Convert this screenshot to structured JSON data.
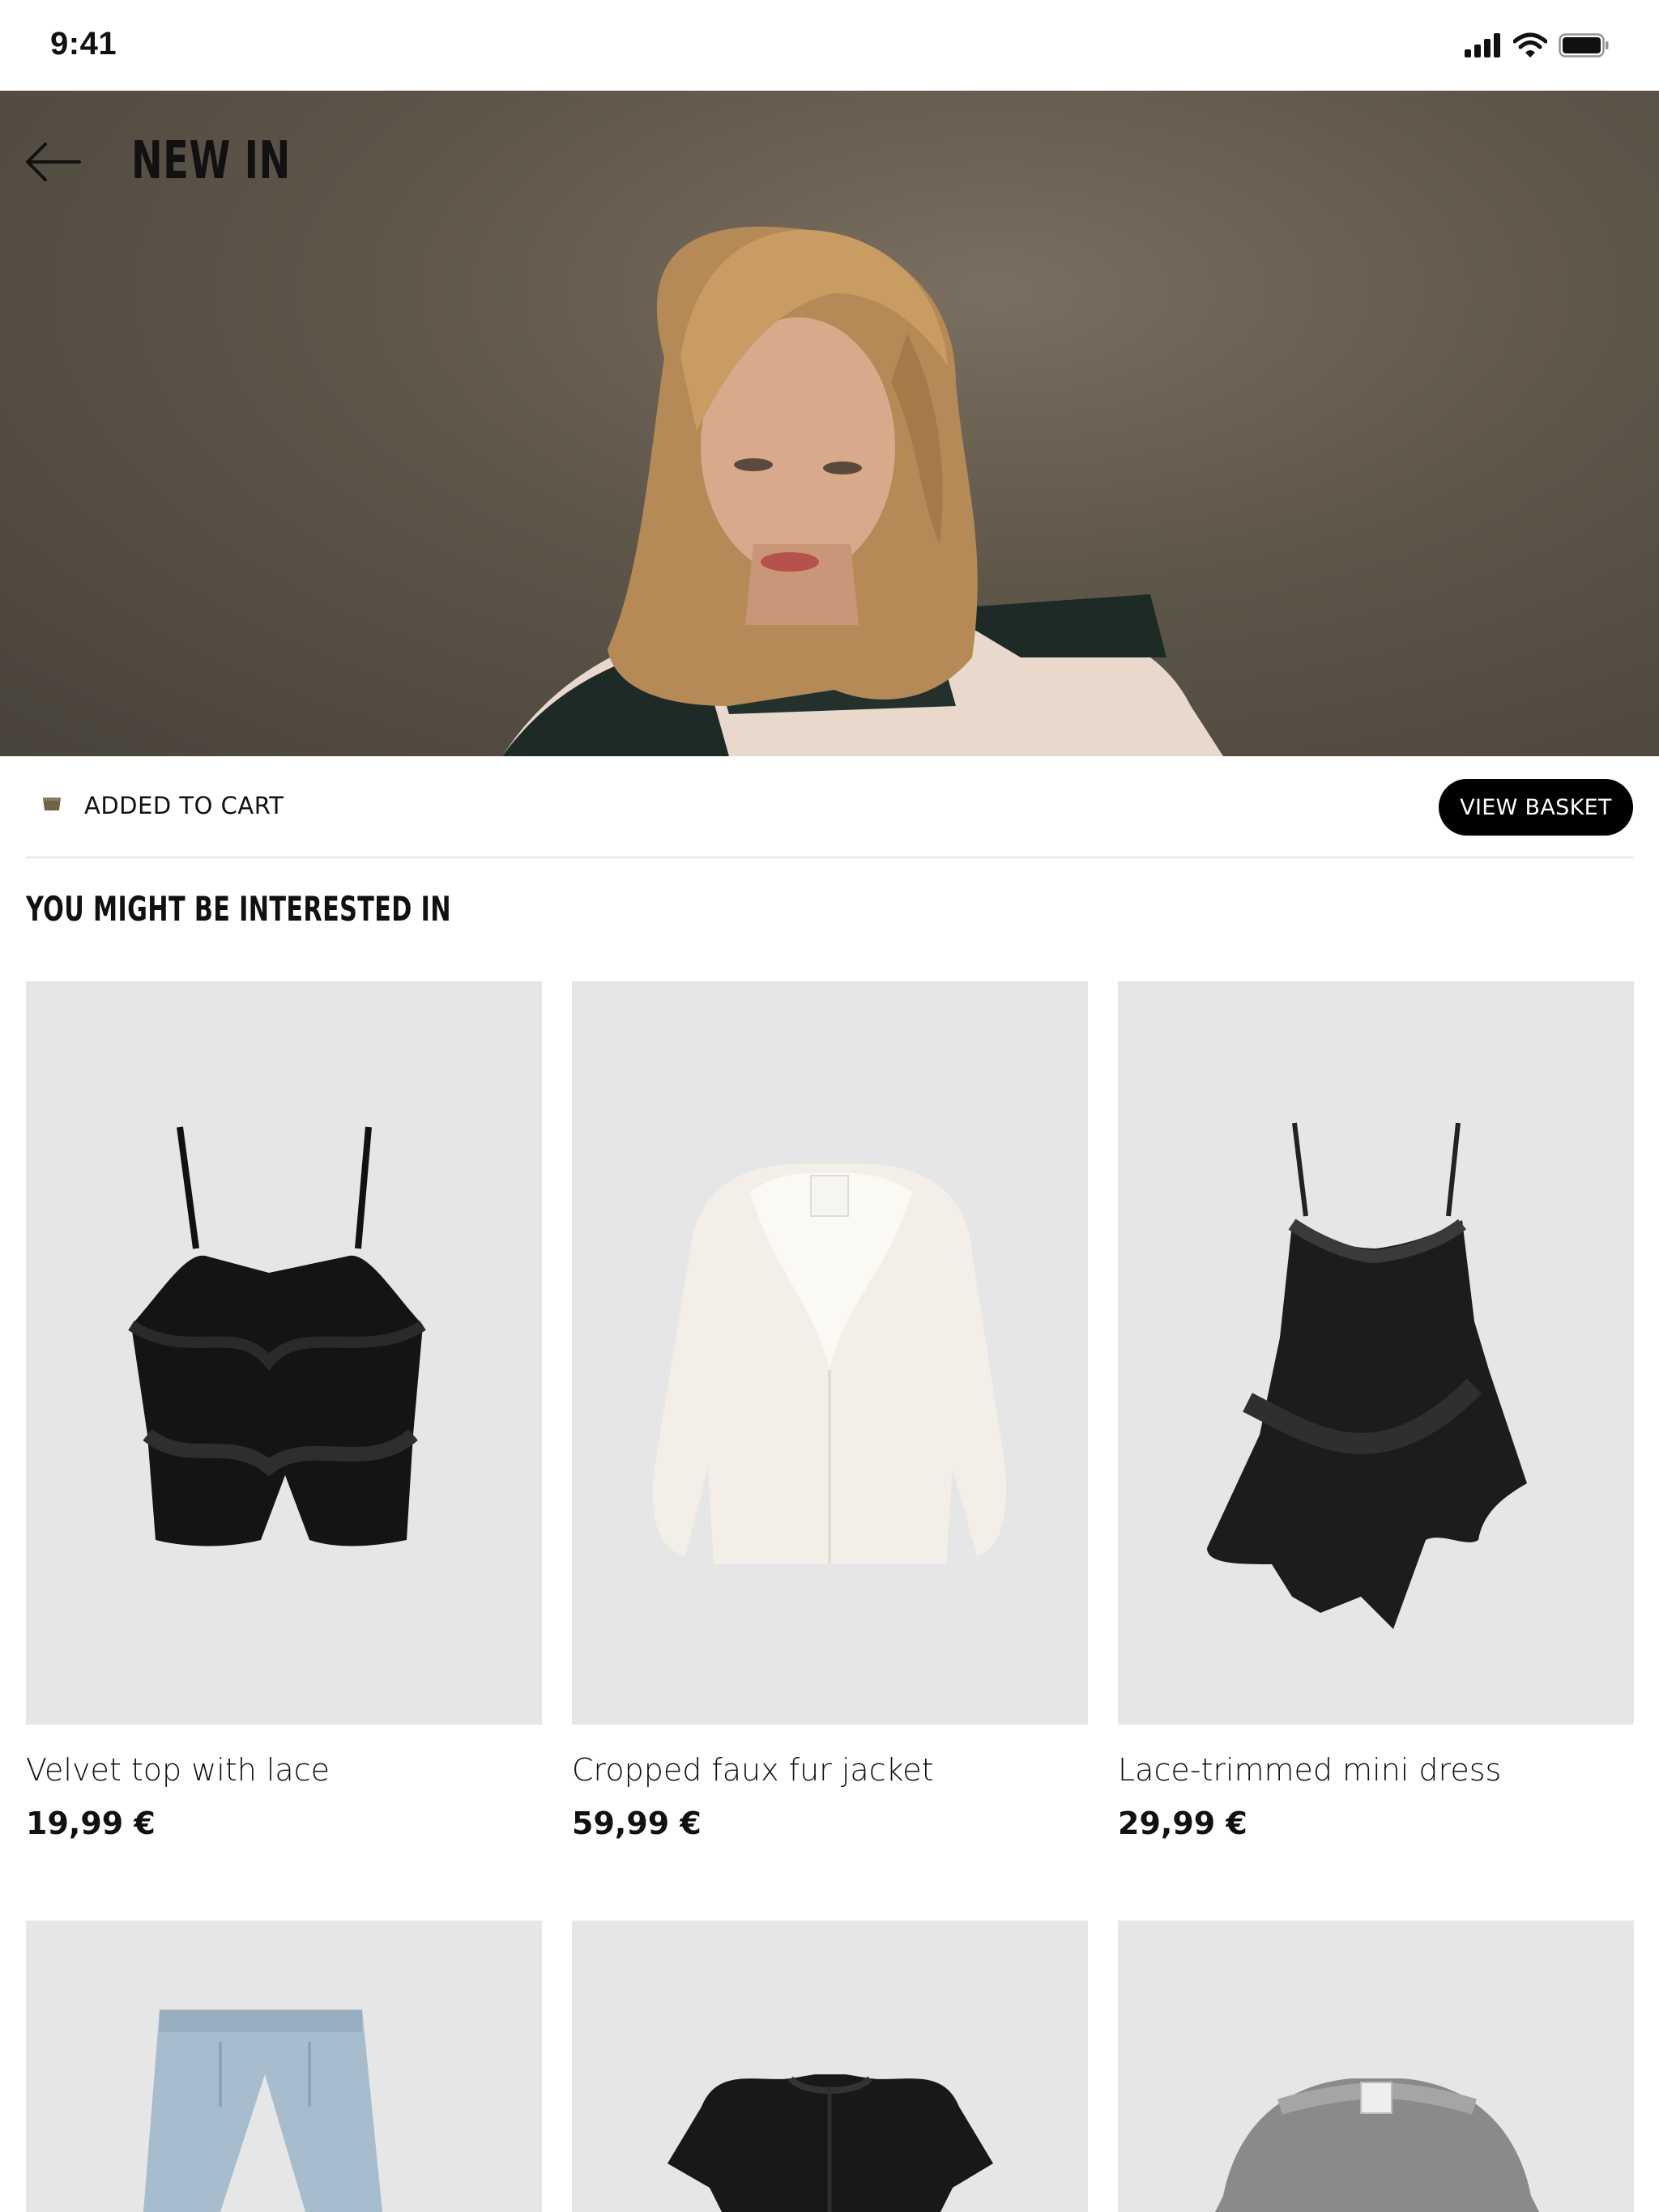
{
  "status_bar": {
    "time": "9:41"
  },
  "header": {
    "title": "NEW IN"
  },
  "cart_notice": {
    "text": "ADDED TO CART",
    "button_label": "VIEW BASKET"
  },
  "recommendations": {
    "title": "YOU MIGHT BE INTERESTED IN",
    "products": [
      {
        "name": "Velvet top with lace",
        "price": "19,99 €"
      },
      {
        "name": "Cropped faux fur jacket",
        "price": "59,99 €"
      },
      {
        "name": "Lace-trimmed mini dress",
        "price": "29,99 €"
      }
    ],
    "next_row": [
      {
        "item": "jeans"
      },
      {
        "item": "velvet-top"
      },
      {
        "item": "grey-faux-fur-jacket"
      }
    ]
  },
  "colors": {
    "accent": "#000000",
    "card_bg": "#e6e6e6",
    "divider": "#e3e3e3"
  }
}
